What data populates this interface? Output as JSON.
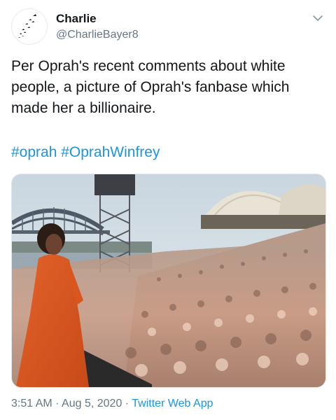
{
  "user": {
    "display_name": "Charlie",
    "handle": "@CharlieBayer8"
  },
  "tweet": {
    "text": "Per Oprah's recent comments about white people, a picture of Oprah's fanbase which made her a billionaire.",
    "hashtags": [
      "#oprah",
      "#OprahWinfrey"
    ]
  },
  "meta": {
    "time": "3:51 AM",
    "separator": "·",
    "date": "Aug 5, 2020",
    "app": "Twitter Web App"
  },
  "colors": {
    "link": "#1b95e0",
    "secondary": "#657786",
    "text": "#14171a"
  }
}
